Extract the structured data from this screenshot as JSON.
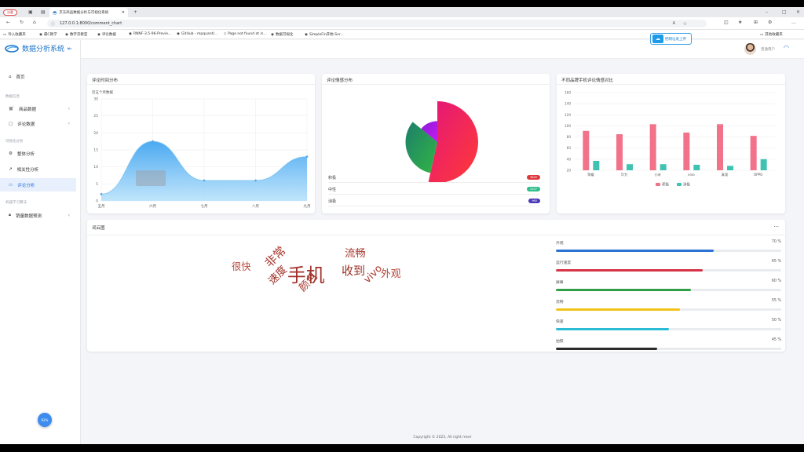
{
  "browser": {
    "profile_badge": "访客",
    "tab_title": "京东商品数据分析与可视化系统",
    "url": "127.0.0.1:8000/comment_chart",
    "bookmarks": [
      "导入收藏夹",
      "最C教学",
      "数字货教室",
      "评论数据",
      "RNNF-3.5-96-Previe...",
      "GitHub - mpquant/...",
      "Page not found at /s...",
      "数据可视化",
      "SimpleFin开始-Snr..."
    ],
    "bookmarks_right": "其他收藏夹"
  },
  "app": {
    "title": "数据分析系统",
    "collapse_icon": "menu-fold-icon",
    "upload_label": "把网址发上传",
    "user_name": "普通用户",
    "fab_label": "92%"
  },
  "sidebar": {
    "home": "首页",
    "group_data": "数据信息",
    "items_data": [
      "商品数据",
      "评论数据"
    ],
    "group_analysis": "可视化分析",
    "items_analysis": [
      "整体分析",
      "相关性分析",
      "评论分析"
    ],
    "group_ml": "机器学习算法",
    "items_ml": [
      "销量数据预测"
    ]
  },
  "cards": {
    "time_title": "评论时间分布",
    "time_subtitle": "近五个月数据",
    "sentiment_title": "评论情感分布",
    "brand_title": "不同品牌手机评论情感对比",
    "wordcloud_title": "词云图",
    "wordcloud_menu": "..."
  },
  "sentiment_legend": [
    {
      "label": "积极",
      "value": "3645",
      "color": "#e0373b"
    },
    {
      "label": "中性",
      "value": "2207",
      "color": "#2fbf8a"
    },
    {
      "label": "消极",
      "value": "960",
      "color": "#4b3bb8"
    }
  ],
  "chart_data": [
    {
      "type": "area",
      "categories": [
        "五月",
        "六月",
        "七月",
        "八月",
        "九月"
      ],
      "values": [
        2,
        17.5,
        6,
        6,
        13
      ],
      "ylim": [
        0,
        30
      ],
      "yticks": [
        0,
        5,
        10,
        15,
        20,
        25,
        30
      ],
      "title": "评论时间分布",
      "subtitle": "近五个月数据",
      "color": "#5db3ef"
    },
    {
      "type": "pie",
      "subtype": "rose",
      "labels": [
        "积极",
        "中性",
        "消极"
      ],
      "values": [
        3645,
        2207,
        960
      ],
      "colors": [
        "#f0345c",
        "#2ba55a",
        "#b516e8"
      ]
    },
    {
      "type": "bar",
      "categories": [
        "荣耀",
        "华为",
        "小米",
        "vivo",
        "真我",
        "OPPO"
      ],
      "series": [
        {
          "name": "积极",
          "values": [
            91,
            85,
            103,
            88,
            103,
            82
          ],
          "color": "#f2728a"
        },
        {
          "name": "消极",
          "values": [
            37,
            31,
            31,
            30,
            28,
            40
          ],
          "color": "#3fc2b2"
        }
      ],
      "ylim": [
        20,
        160
      ],
      "yticks": [
        20,
        40,
        60,
        80,
        100,
        120,
        140,
        160
      ],
      "legend": "bottom",
      "grid": true
    }
  ],
  "wordcloud": [
    {
      "text": "手机",
      "size": 36
    },
    {
      "text": "非常",
      "size": 20
    },
    {
      "text": "很快",
      "size": 15
    },
    {
      "text": "速度",
      "size": 17
    },
    {
      "text": "颜色",
      "size": 17
    },
    {
      "text": "收到",
      "size": 20
    },
    {
      "text": "流畅",
      "size": 17
    },
    {
      "text": "vivo",
      "size": 16
    },
    {
      "text": "外观",
      "size": 16
    }
  ],
  "keywords": [
    {
      "label": "外观",
      "value": "70 %",
      "pct": 70,
      "color": "#2c73d2"
    },
    {
      "label": "运行速度",
      "value": "65 %",
      "pct": 65,
      "color": "#d63447"
    },
    {
      "label": "屏幕",
      "value": "60 %",
      "pct": 60,
      "color": "#2f9e44"
    },
    {
      "label": "流畅",
      "value": "55 %",
      "pct": 55,
      "color": "#f2c218"
    },
    {
      "label": "快速",
      "value": "50 %",
      "pct": 50,
      "color": "#29bcd4"
    },
    {
      "label": "拍照",
      "value": "45 %",
      "pct": 45,
      "color": "#2b2b2b"
    }
  ],
  "footer": "Copyright © 2025, All right reser"
}
